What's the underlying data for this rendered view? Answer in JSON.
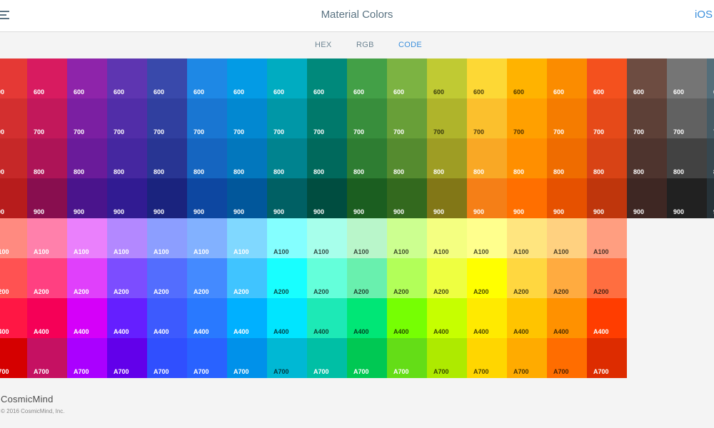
{
  "header": {
    "title": "Material Colors",
    "platform_link": "iOS"
  },
  "tabs": [
    {
      "label": "HEX",
      "active": false
    },
    {
      "label": "RGB",
      "active": false
    },
    {
      "label": "CODE",
      "active": true
    }
  ],
  "palette": {
    "row_labels": [
      "600",
      "700",
      "800",
      "900",
      "A100",
      "A200",
      "A400",
      "A700"
    ],
    "columns": [
      {
        "name": "red",
        "colors": [
          "#e53935",
          "#d32f2f",
          "#c62828",
          "#b71c1c",
          "#ff8a80",
          "#ff5252",
          "#ff1744",
          "#d50000"
        ]
      },
      {
        "name": "pink",
        "colors": [
          "#d81b60",
          "#c2185b",
          "#ad1457",
          "#880e4f",
          "#ff80ab",
          "#ff4081",
          "#f50057",
          "#c51162"
        ]
      },
      {
        "name": "purple",
        "colors": [
          "#8e24aa",
          "#7b1fa2",
          "#6a1b9a",
          "#4a148c",
          "#ea80fc",
          "#e040fb",
          "#d500f9",
          "#aa00ff"
        ]
      },
      {
        "name": "deep-purple",
        "colors": [
          "#5e35b1",
          "#512da8",
          "#4527a0",
          "#311b92",
          "#b388ff",
          "#7c4dff",
          "#651fff",
          "#6200ea"
        ]
      },
      {
        "name": "indigo",
        "colors": [
          "#3949ab",
          "#303f9f",
          "#283593",
          "#1a237e",
          "#8c9eff",
          "#536dfe",
          "#3d5afe",
          "#304ffe"
        ]
      },
      {
        "name": "blue",
        "colors": [
          "#1e88e5",
          "#1976d2",
          "#1565c0",
          "#0d47a1",
          "#82b1ff",
          "#448aff",
          "#2979ff",
          "#2962ff"
        ]
      },
      {
        "name": "light-blue",
        "colors": [
          "#039be5",
          "#0288d1",
          "#0277bd",
          "#01579b",
          "#80d8ff",
          "#40c4ff",
          "#00b0ff",
          "#0091ea"
        ]
      },
      {
        "name": "cyan",
        "colors": [
          "#00acc1",
          "#0097a7",
          "#00838f",
          "#006064",
          "#84ffff",
          "#18ffff",
          "#00e5ff",
          "#00b8d4"
        ]
      },
      {
        "name": "teal",
        "colors": [
          "#00897b",
          "#00796b",
          "#00695c",
          "#004d40",
          "#a7ffeb",
          "#64ffda",
          "#1de9b6",
          "#00bfa5"
        ]
      },
      {
        "name": "green",
        "colors": [
          "#43a047",
          "#388e3c",
          "#2e7d32",
          "#1b5e20",
          "#b9f6ca",
          "#69f0ae",
          "#00e676",
          "#00c853"
        ]
      },
      {
        "name": "light-green",
        "colors": [
          "#7cb342",
          "#689f38",
          "#558b2f",
          "#33691e",
          "#ccff90",
          "#b2ff59",
          "#76ff03",
          "#64dd17"
        ]
      },
      {
        "name": "lime",
        "colors": [
          "#c0ca33",
          "#afb42b",
          "#9e9d24",
          "#827717",
          "#f4ff81",
          "#eeff41",
          "#c6ff00",
          "#aeea00"
        ]
      },
      {
        "name": "yellow",
        "colors": [
          "#fdd835",
          "#fbc02d",
          "#f9a825",
          "#f57f17",
          "#ffff8d",
          "#ffff00",
          "#ffea00",
          "#ffd600"
        ]
      },
      {
        "name": "amber",
        "colors": [
          "#ffb300",
          "#ffa000",
          "#ff8f00",
          "#ff6f00",
          "#ffe57f",
          "#ffd740",
          "#ffc400",
          "#ffab00"
        ]
      },
      {
        "name": "orange",
        "colors": [
          "#fb8c00",
          "#f57c00",
          "#ef6c00",
          "#e65100",
          "#ffd180",
          "#ffab40",
          "#ff9100",
          "#ff6d00"
        ]
      },
      {
        "name": "deep-orange",
        "colors": [
          "#f4511e",
          "#e64a19",
          "#d84315",
          "#bf360c",
          "#ff9e80",
          "#ff6e40",
          "#ff3d00",
          "#dd2c00"
        ]
      },
      {
        "name": "brown",
        "colors": [
          "#6d4c41",
          "#5d4037",
          "#4e342e",
          "#3e2723"
        ]
      },
      {
        "name": "grey",
        "colors": [
          "#757575",
          "#616161",
          "#424242",
          "#212121"
        ]
      },
      {
        "name": "blue-grey",
        "colors": [
          "#546e7a",
          "#455a64",
          "#37474f",
          "#263238"
        ]
      }
    ],
    "dark_text_cells": [
      [
        7,
        4
      ],
      [
        7,
        5
      ],
      [
        7,
        6
      ],
      [
        7,
        7
      ],
      [
        8,
        4
      ],
      [
        8,
        5
      ],
      [
        8,
        6
      ],
      [
        9,
        4
      ],
      [
        9,
        5
      ],
      [
        9,
        6
      ],
      [
        10,
        4
      ],
      [
        10,
        5
      ],
      [
        10,
        6
      ],
      [
        11,
        0
      ],
      [
        11,
        1
      ],
      [
        11,
        4
      ],
      [
        11,
        5
      ],
      [
        11,
        6
      ],
      [
        11,
        7
      ],
      [
        12,
        0
      ],
      [
        12,
        1
      ],
      [
        12,
        4
      ],
      [
        12,
        5
      ],
      [
        12,
        6
      ],
      [
        12,
        7
      ],
      [
        13,
        0
      ],
      [
        13,
        1
      ],
      [
        13,
        4
      ],
      [
        13,
        5
      ],
      [
        13,
        6
      ],
      [
        13,
        7
      ],
      [
        14,
        4
      ],
      [
        14,
        5
      ],
      [
        14,
        6
      ],
      [
        14,
        7
      ],
      [
        15,
        4
      ],
      [
        15,
        5
      ]
    ]
  },
  "footer": {
    "brand": "CosmicMind",
    "copyright": "© 2016 CosmicMind, Inc."
  },
  "colors": {
    "accent": "#3b8fdc",
    "title": "#5a7382",
    "background": "#f4f4f4"
  }
}
